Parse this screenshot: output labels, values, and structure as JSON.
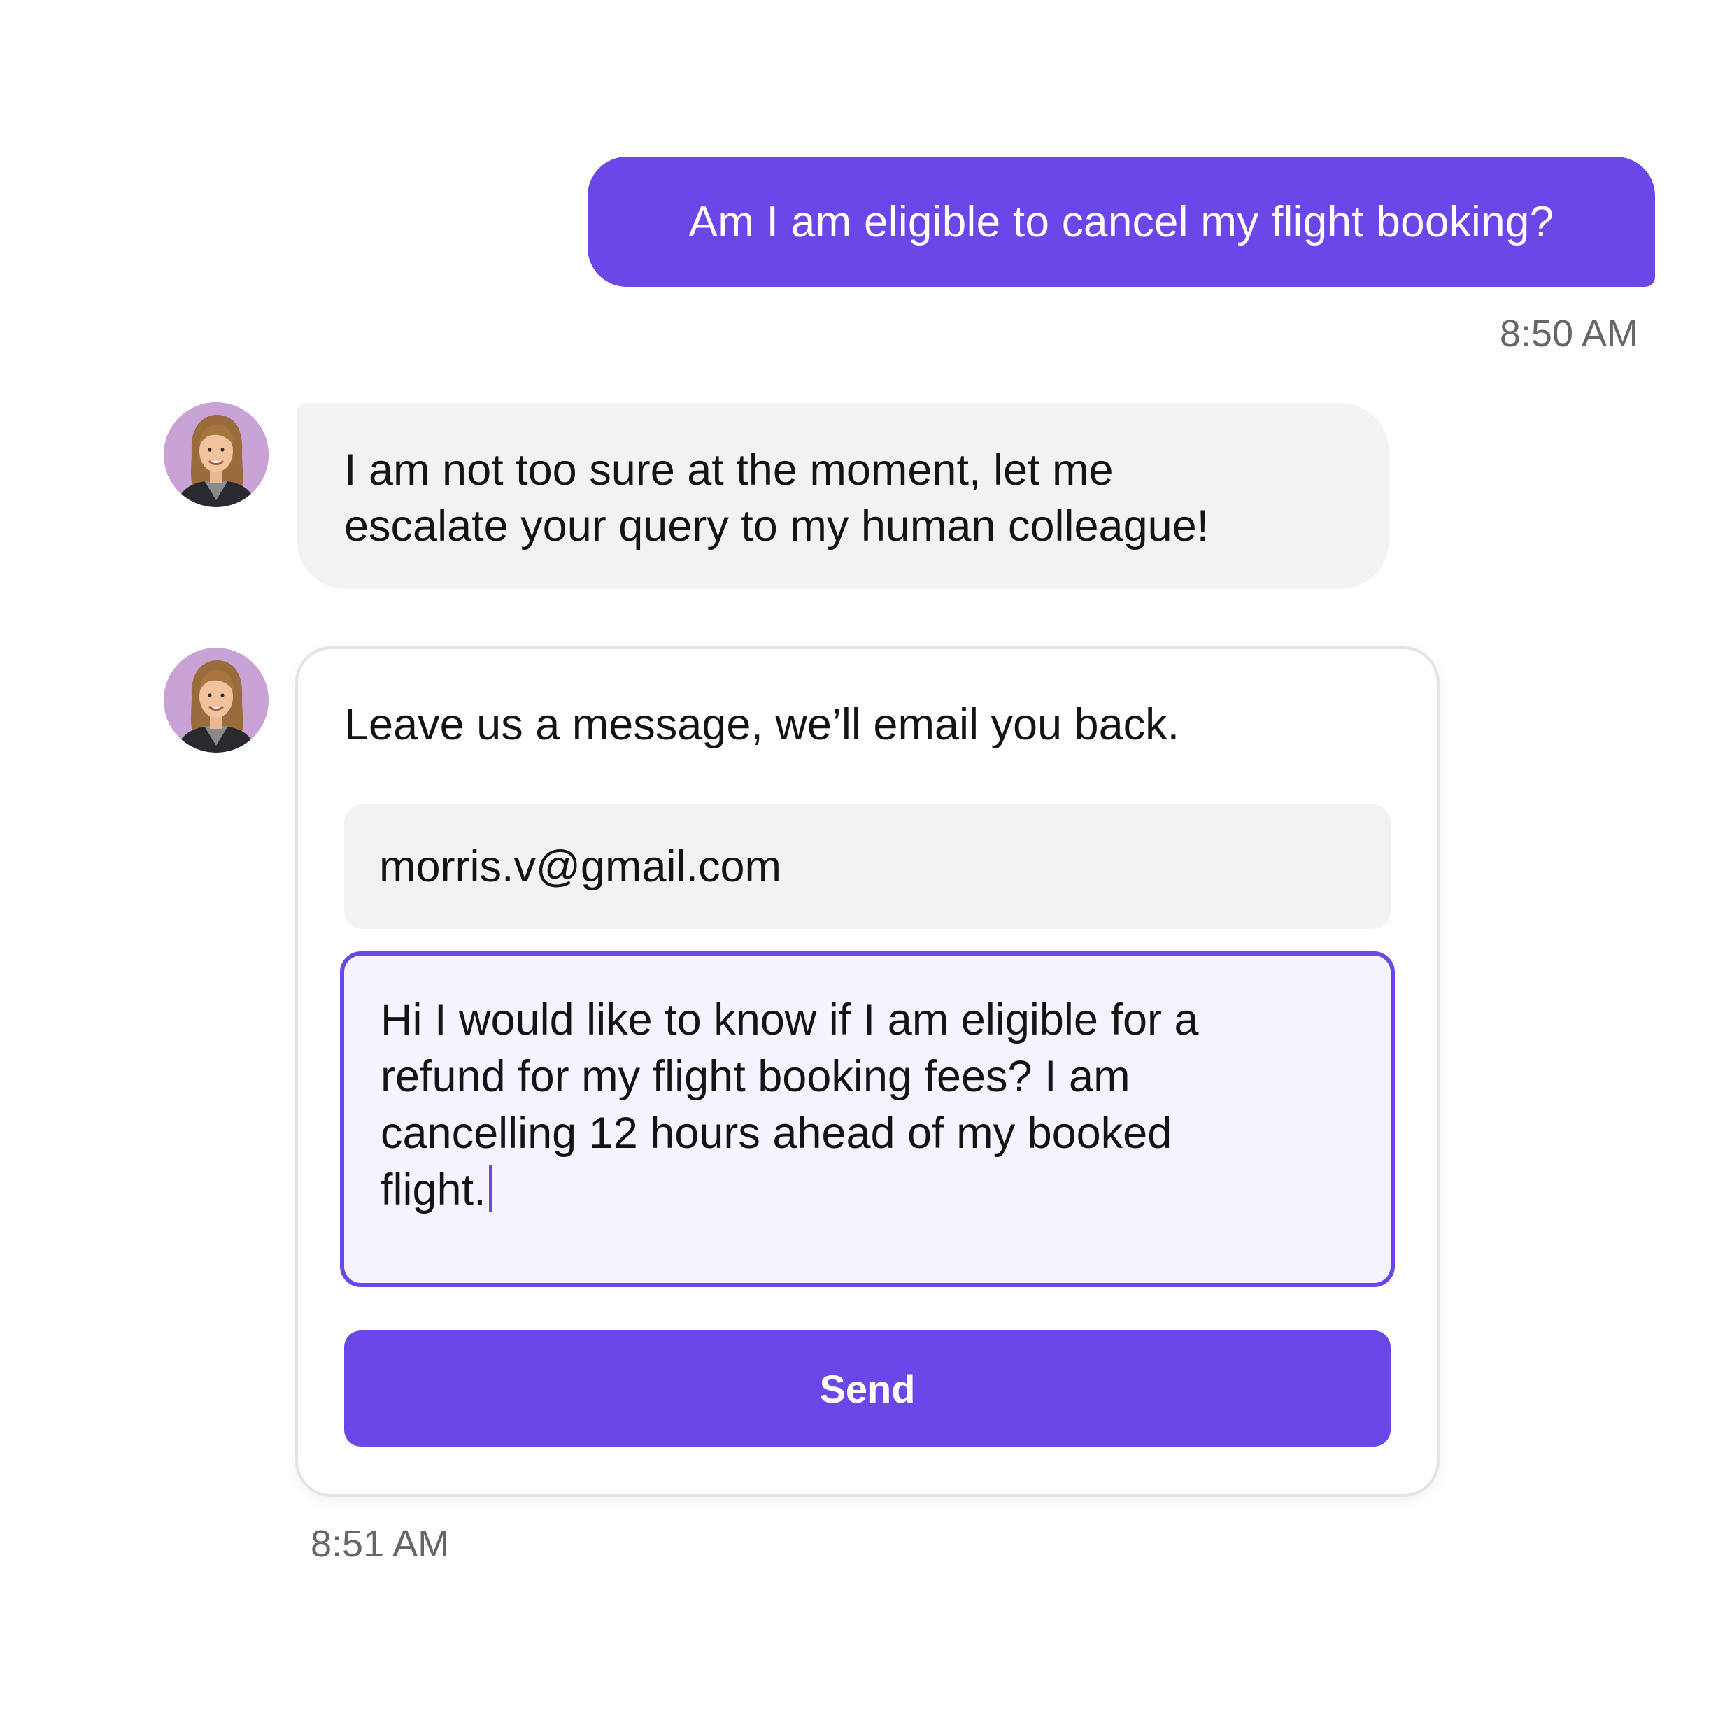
{
  "conversation": {
    "user_message": {
      "text": "Am I am eligible to cancel my flight booking?",
      "timestamp": "8:50 AM"
    },
    "bot_message": {
      "lines": [
        "I am not too sure at the moment, let me",
        "escalate your query to my human colleague!"
      ]
    },
    "contact_form": {
      "title": "Leave us a message, we’ll email you back.",
      "email_value": "morris.v@gmail.com",
      "message_lines": [
        "Hi I would like to know if I am eligible for a",
        "refund for my flight booking fees? I am",
        "cancelling 12 hours ahead of my booked",
        "flight."
      ],
      "send_label": "Send",
      "timestamp": "8:51 AM"
    }
  },
  "colors": {
    "accent": "#6b47ea",
    "bot_bubble": "#f2f2f2",
    "input_focus_bg": "#f4f3fe",
    "avatar_bg": "#c9a2d6",
    "timestamp": "#666666"
  },
  "icons": {
    "agent_avatar": "agent-avatar-photo"
  }
}
